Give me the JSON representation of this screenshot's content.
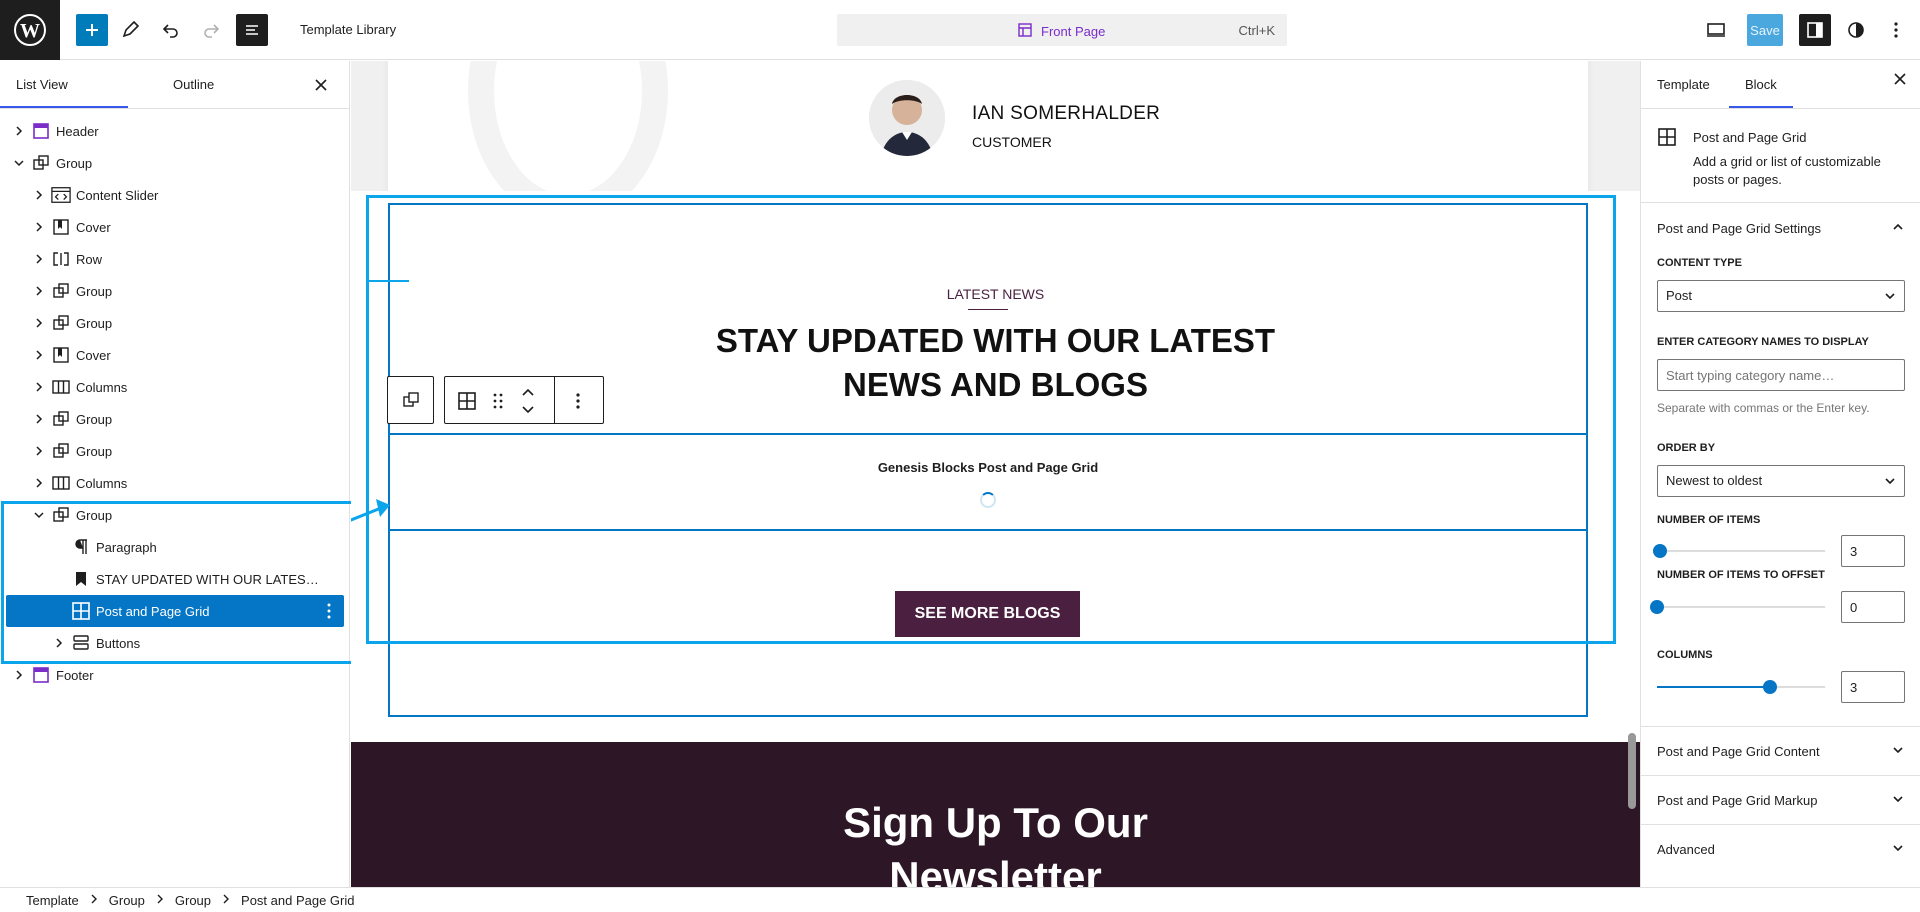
{
  "header": {
    "doc_title": "Template Library",
    "command_label": "Front Page",
    "command_shortcut": "Ctrl+K",
    "save_label": "Save"
  },
  "left_panel": {
    "tabs": [
      "List View",
      "Outline"
    ],
    "tree": [
      {
        "label": "Header",
        "icon": "template-part-icon",
        "level": 0,
        "expand": "collapsed"
      },
      {
        "label": "Group",
        "icon": "group-icon",
        "level": 0,
        "expand": "expanded"
      },
      {
        "label": "Content Slider",
        "icon": "code-slider-icon",
        "level": 1,
        "expand": "collapsed"
      },
      {
        "label": "Cover",
        "icon": "cover-icon",
        "level": 1,
        "expand": "collapsed"
      },
      {
        "label": "Row",
        "icon": "row-icon",
        "level": 1,
        "expand": "collapsed"
      },
      {
        "label": "Group",
        "icon": "group-icon",
        "level": 1,
        "expand": "collapsed"
      },
      {
        "label": "Group",
        "icon": "group-icon",
        "level": 1,
        "expand": "collapsed"
      },
      {
        "label": "Cover",
        "icon": "cover-icon",
        "level": 1,
        "expand": "collapsed"
      },
      {
        "label": "Columns",
        "icon": "columns-icon",
        "level": 1,
        "expand": "collapsed"
      },
      {
        "label": "Group",
        "icon": "group-icon",
        "level": 1,
        "expand": "collapsed"
      },
      {
        "label": "Group",
        "icon": "group-icon",
        "level": 1,
        "expand": "collapsed"
      },
      {
        "label": "Columns",
        "icon": "columns-icon",
        "level": 1,
        "expand": "collapsed"
      },
      {
        "label": "Group",
        "icon": "group-icon",
        "level": 1,
        "expand": "expanded"
      },
      {
        "label": "Paragraph",
        "icon": "paragraph-icon",
        "level": 2,
        "expand": "none"
      },
      {
        "label": "STAY UPDATED WITH OUR LATES…",
        "icon": "bookmark-icon",
        "level": 2,
        "expand": "none"
      },
      {
        "label": "Post and Page Grid",
        "icon": "grid-icon",
        "level": 2,
        "expand": "none",
        "selected": true
      },
      {
        "label": "Buttons",
        "icon": "buttons-icon",
        "level": 2,
        "expand": "collapsed"
      },
      {
        "label": "Footer",
        "icon": "template-part-icon",
        "level": 0,
        "expand": "collapsed"
      }
    ]
  },
  "canvas": {
    "testimonial_name": "IAN SOMERHALDER",
    "testimonial_role": "CUSTOMER",
    "kicker": "LATEST NEWS",
    "headline_line1": "STAY UPDATED WITH OUR LATEST",
    "headline_line2": "NEWS AND BLOGS",
    "grid_placeholder": "Genesis Blocks Post and Page Grid",
    "button_label": "SEE MORE BLOGS",
    "newsletter_line1": "Sign Up To Our",
    "newsletter_line2": "Newsletter"
  },
  "right_panel": {
    "tabs": [
      "Template",
      "Block"
    ],
    "block_name": "Post and Page Grid",
    "block_description": "Add a grid or list of customizable posts or pages.",
    "settings_title": "Post and Page Grid Settings",
    "content_type_label": "CONTENT TYPE",
    "content_type_value": "Post",
    "category_label": "ENTER CATEGORY NAMES TO DISPLAY",
    "category_placeholder": "Start typing category name…",
    "category_help": "Separate with commas or the Enter key.",
    "order_label": "ORDER BY",
    "order_value": "Newest to oldest",
    "items_label": "NUMBER OF ITEMS",
    "items_value": "3",
    "items_fraction": 0.02,
    "offset_label": "NUMBER OF ITEMS TO OFFSET",
    "offset_value": "0",
    "offset_fraction": 0.0,
    "columns_label": "COLUMNS",
    "columns_value": "3",
    "columns_fraction": 0.67,
    "collapsed_panels": [
      "Post and Page Grid Content",
      "Post and Page Grid Markup",
      "Advanced"
    ]
  },
  "breadcrumbs": [
    "Template",
    "Group",
    "Group",
    "Post and Page Grid"
  ],
  "colors": {
    "accent": "#0575c5",
    "annotation": "#0ba5ec",
    "brand": "#4a1f3f"
  }
}
